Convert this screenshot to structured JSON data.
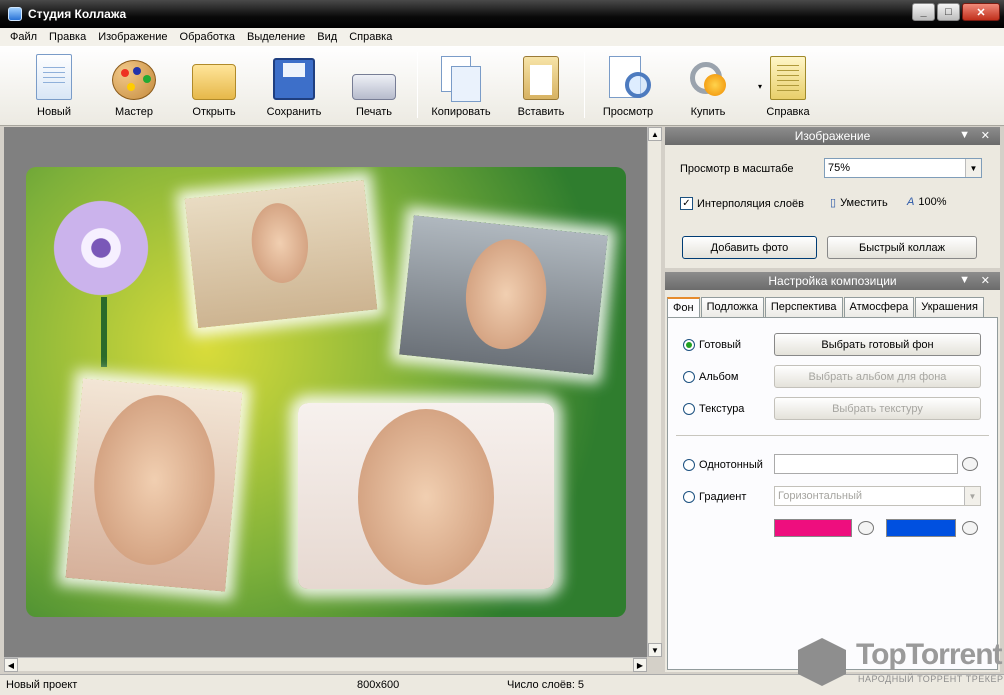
{
  "window": {
    "title": "Студия Коллажа",
    "minimize": "_",
    "maximize": "□",
    "close": "✕"
  },
  "menu": [
    "Файл",
    "Правка",
    "Изображение",
    "Обработка",
    "Выделение",
    "Вид",
    "Справка"
  ],
  "toolbar": {
    "new": "Новый",
    "wizard": "Мастер",
    "open": "Открыть",
    "save": "Сохранить",
    "print": "Печать",
    "copy": "Копировать",
    "paste": "Вставить",
    "preview": "Просмотр",
    "buy": "Купить",
    "help": "Справка",
    "buy_caret": "▾"
  },
  "image_panel": {
    "title": "Изображение",
    "zoom_label": "Просмотр в масштабе",
    "zoom_value": "75%",
    "interpolation_label": "Интерполяция слоёв",
    "interpolation_checked": true,
    "fit_label": "Уместить",
    "actual_label": "100%",
    "add_photo": "Добавить фото",
    "quick_collage": "Быстрый коллаж"
  },
  "composition_panel": {
    "title": "Настройка композиции",
    "tabs": [
      "Фон",
      "Подложка",
      "Перспектива",
      "Атмосфера",
      "Украшения"
    ],
    "active_tab": "Фон",
    "ready_label": "Готовый",
    "ready_button": "Выбрать готовый фон",
    "album_label": "Альбом",
    "album_button": "Выбрать альбом для фона",
    "texture_label": "Текстура",
    "texture_button": "Выбрать текстуру",
    "solid_label": "Однотонный",
    "gradient_label": "Градиент",
    "gradient_type": "Горизонтальный",
    "gradient_color1": "#ee0e7e",
    "gradient_color2": "#0050e0"
  },
  "status": {
    "project": "Новый проект",
    "size": "800x600",
    "layers": "Число слоёв: 5"
  },
  "watermark": {
    "title": "TopTorrent",
    "subtitle": "НАРОДНЫЙ ТОРРЕНТ ТРЕКЕР"
  },
  "colors": {
    "titlebar": "#000000",
    "panel_header": "#7a7a7a",
    "canvas_bg": "#808080"
  }
}
